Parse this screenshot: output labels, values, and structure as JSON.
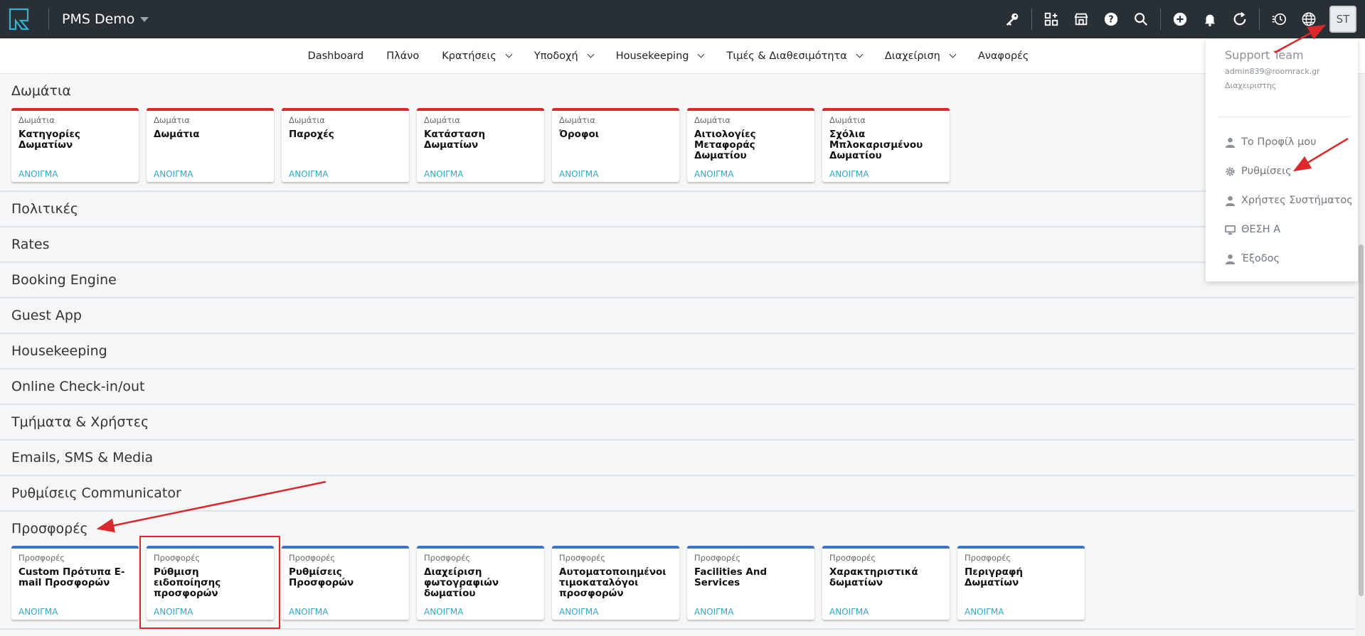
{
  "topbar": {
    "app_title": "PMS Demo",
    "avatar_initials": "ST",
    "icons": [
      "key-icon",
      "apps-icon",
      "store-icon",
      "help-icon",
      "search-icon",
      "add-icon",
      "bell-icon",
      "refresh-icon",
      "history-icon",
      "globe-icon"
    ]
  },
  "nav": {
    "items": [
      {
        "label": "Dashboard",
        "dropdown": false
      },
      {
        "label": "Πλάνο",
        "dropdown": false
      },
      {
        "label": "Κρατήσεις",
        "dropdown": true
      },
      {
        "label": "Υποδοχή",
        "dropdown": true
      },
      {
        "label": "Housekeeping",
        "dropdown": true
      },
      {
        "label": "Τιμές & Διαθεσιμότητα",
        "dropdown": true
      },
      {
        "label": "Διαχείριση",
        "dropdown": true
      },
      {
        "label": "Αναφορές",
        "dropdown": false
      }
    ]
  },
  "sections": {
    "rooms": {
      "title": "Δωμάτια",
      "open_label": "ΑΝΟΙΓΜΑ",
      "cards": [
        {
          "category": "Δωμάτια",
          "title": "Κατηγορίες Δωματίων"
        },
        {
          "category": "Δωμάτια",
          "title": "Δωμάτια"
        },
        {
          "category": "Δωμάτια",
          "title": "Παροχές"
        },
        {
          "category": "Δωμάτια",
          "title": "Κατάσταση Δωματίων"
        },
        {
          "category": "Δωμάτια",
          "title": "Όροφοι"
        },
        {
          "category": "Δωμάτια",
          "title": "Αιτιολογίες Μεταφοράς Δωματίου"
        },
        {
          "category": "Δωμάτια",
          "title": "Σχόλια Μπλοκαρισμένου Δωματίου"
        }
      ]
    },
    "collapsed": [
      "Πολιτικές",
      "Rates",
      "Booking Engine",
      "Guest App",
      "Housekeeping",
      "Online Check-in/out",
      "Τμήματα & Χρήστες",
      "Emails, SMS & Media",
      "Ρυθμίσεις Communicator"
    ],
    "offers": {
      "title": "Προσφορές",
      "open_label": "ΑΝΟΙΓΜΑ",
      "cards": [
        {
          "category": "Προσφορές",
          "title": "Custom Πρότυπα E-mail Προσφορών"
        },
        {
          "category": "Προσφορές",
          "title": "Ρύθμιση ειδοποίησης προσφορών"
        },
        {
          "category": "Προσφορές",
          "title": "Ρυθμίσεις Προσφορών"
        },
        {
          "category": "Προσφορές",
          "title": "Διαχείριση φωτογραφιών δωματίου"
        },
        {
          "category": "Προσφορές",
          "title": "Αυτοματοποιημένοι τιμοκαταλόγοι προσφορών"
        },
        {
          "category": "Προσφορές",
          "title": "Facilities And Services"
        },
        {
          "category": "Προσφορές",
          "title": "Χαρακτηριστικά δωματίων"
        },
        {
          "category": "Προσφορές",
          "title": "Περιγραφή Δωματίων"
        }
      ]
    }
  },
  "user_menu": {
    "name": "Support Team",
    "email": "admin839@roomrack.gr",
    "role": "Διαχειριστης",
    "items": [
      {
        "label": "Το Προφίλ μου",
        "icon": "user-icon"
      },
      {
        "label": "Ρυθμίσεις",
        "icon": "gear-icon"
      },
      {
        "label": "Χρήστες Συστήματος",
        "icon": "user-icon"
      },
      {
        "label": "ΘΕΣΗ Α",
        "icon": "monitor-icon"
      },
      {
        "label": "Έξοδος",
        "icon": "user-icon"
      }
    ]
  },
  "colors": {
    "topbar": "#293035",
    "rooms_accent": "#d9292c",
    "offers_accent": "#3f73c9",
    "link": "#32a8c8",
    "annotation": "#d9292c"
  }
}
